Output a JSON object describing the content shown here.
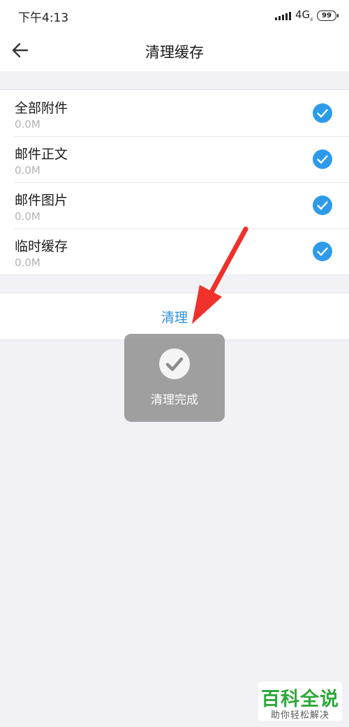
{
  "status_bar": {
    "time": "下午4:13",
    "network": "4G",
    "network_sub": "ıl",
    "battery": "99"
  },
  "header": {
    "title": "清理缓存",
    "back_icon": "arrow-left-icon"
  },
  "cache_items": [
    {
      "title": "全部附件",
      "size": "0.0M",
      "checked": true
    },
    {
      "title": "邮件正文",
      "size": "0.0M",
      "checked": true
    },
    {
      "title": "邮件图片",
      "size": "0.0M",
      "checked": true
    },
    {
      "title": "临时缓存",
      "size": "0.0M",
      "checked": true
    }
  ],
  "actions": {
    "clean_label": "清理"
  },
  "toast": {
    "message": "清理完成",
    "icon": "checkmark-circle-icon"
  },
  "watermark": {
    "title": "百科全说",
    "subtitle": "助你轻松解决"
  },
  "colors": {
    "accent": "#2d9bea",
    "link": "#2d8fdc",
    "background": "#f2f2f6",
    "annotation_arrow": "#f0302a",
    "watermark_green": "#2fa83a"
  }
}
